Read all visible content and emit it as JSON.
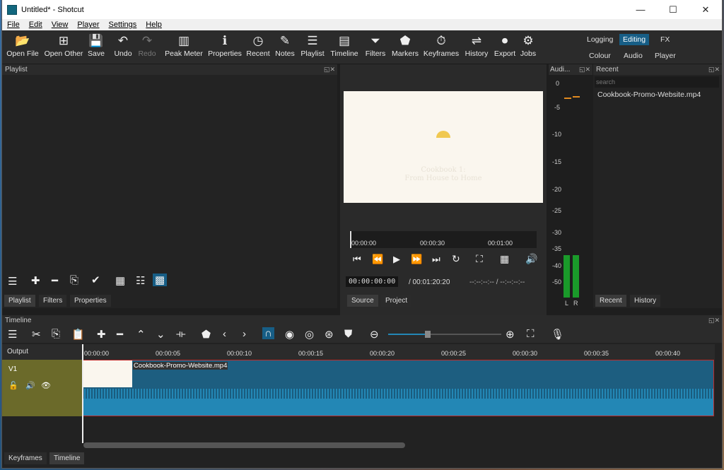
{
  "window": {
    "title": "Untitled* - Shotcut",
    "min": "—",
    "max": "☐",
    "close": "✕"
  },
  "menu": [
    "File",
    "Edit",
    "View",
    "Player",
    "Settings",
    "Help"
  ],
  "toolbar": [
    {
      "label": "Open File",
      "icon": "📂"
    },
    {
      "label": "Open Other",
      "icon": "⊞"
    },
    {
      "label": "Save",
      "icon": "💾"
    },
    {
      "label": "Undo",
      "icon": "↶"
    },
    {
      "label": "Redo",
      "icon": "↷"
    },
    {
      "label": "Peak Meter",
      "icon": "▥"
    },
    {
      "label": "Properties",
      "icon": "ℹ"
    },
    {
      "label": "Recent",
      "icon": "◷"
    },
    {
      "label": "Notes",
      "icon": "✎"
    },
    {
      "label": "Playlist",
      "icon": "☰"
    },
    {
      "label": "Timeline",
      "icon": "▤"
    },
    {
      "label": "Filters",
      "icon": "⏷"
    },
    {
      "label": "Markers",
      "icon": "⬟"
    },
    {
      "label": "Keyframes",
      "icon": "⏱"
    },
    {
      "label": "History",
      "icon": "⇌"
    },
    {
      "label": "Export",
      "icon": "⏺"
    },
    {
      "label": "Jobs",
      "icon": "⚙"
    }
  ],
  "workspaces": {
    "logging": "Logging",
    "editing": "Editing",
    "fx": "FX",
    "colour": "Colour",
    "audio": "Audio",
    "player": "Player"
  },
  "playlist_panel": {
    "title": "Playlist",
    "tabs": [
      "Playlist",
      "Filters",
      "Properties"
    ]
  },
  "audio_panel": {
    "title": "Audi...",
    "scale": [
      "0",
      "-5",
      "-10",
      "-15",
      "-20",
      "-25",
      "-30",
      "-35",
      "-40",
      "-50"
    ],
    "channels": [
      "L",
      "R"
    ]
  },
  "recent_panel": {
    "title": "Recent",
    "search_placeholder": "search",
    "items": [
      "Cookbook-Promo-Website.mp4"
    ],
    "tabs": [
      "Recent",
      "History"
    ]
  },
  "player": {
    "video_text": [
      "Cookbook 1:",
      "From House to Home"
    ],
    "ruler": [
      "00:00:00",
      "00:00:30",
      "00:01:00"
    ],
    "timecode": "00:00:00:00",
    "duration": "/ 00:01:20:20",
    "inout": "--:--:--:-- / --:--:--:--",
    "tabs": [
      "Source",
      "Project"
    ]
  },
  "timeline": {
    "title": "Timeline",
    "output_label": "Output",
    "track": "V1",
    "clip": "Cookbook-Promo-Website.mp4",
    "ruler": [
      "00:00:00",
      "00:00:05",
      "00:00:10",
      "00:00:15",
      "00:00:20",
      "00:00:25",
      "00:00:30",
      "00:00:35",
      "00:00:40"
    ],
    "bottom_tabs": [
      "Keyframes",
      "Timeline"
    ]
  },
  "colors": {
    "accent": "#175e86",
    "track_bg": "#6b6a2a",
    "clip": "#1d6f94",
    "wave": "#2387b5"
  }
}
